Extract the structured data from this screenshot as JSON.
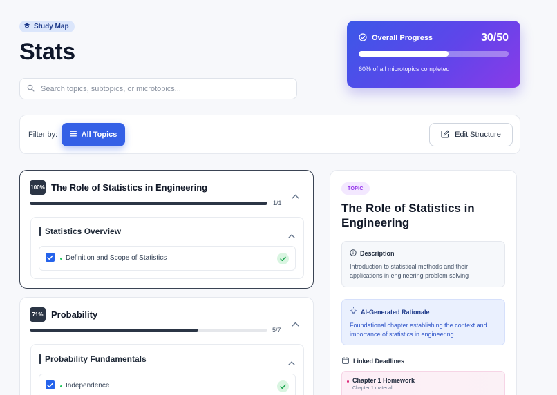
{
  "header": {
    "breadcrumb_pill": "Study Map",
    "page_title": "Stats"
  },
  "search": {
    "placeholder": "Search topics, subtopics, or microtopics..."
  },
  "overall_progress": {
    "label": "Overall Progress",
    "count": "30/50",
    "fraction": 0.6,
    "caption": "60% of all microtopics completed"
  },
  "filter": {
    "label": "Filter by:",
    "all_topics": "All Topics",
    "edit_structure": "Edit Structure"
  },
  "topics": [
    {
      "percent_label": "100%",
      "title": "The Role of Statistics in Engineering",
      "progress": 1.0,
      "count": "1/1",
      "subtopics": [
        {
          "title": "Statistics Overview",
          "microtopics": [
            {
              "label": "Definition and Scope of Statistics",
              "checked": true,
              "done": true
            }
          ]
        }
      ]
    },
    {
      "percent_label": "71%",
      "title": "Probability",
      "progress": 0.71,
      "count": "5/7",
      "subtopics": [
        {
          "title": "Probability Fundamentals",
          "microtopics": [
            {
              "label": "Independence",
              "checked": true,
              "done": true
            }
          ]
        }
      ]
    }
  ],
  "detail": {
    "type_pill": "TOPIC",
    "title": "The Role of Statistics in Engineering",
    "description_label": "Description",
    "description_text": "Introduction to statistical methods and their applications in engineering problem solving",
    "ai_label": "AI-Generated Rationale",
    "ai_text": "Foundational chapter establishing the context and importance of statistics in engineering",
    "linked_label": "Linked Deadlines",
    "deadlines": [
      {
        "title": "Chapter 1 Homework",
        "subtitle": "Chapter 1 material"
      }
    ]
  },
  "colors": {
    "primary": "#3460e6",
    "dark": "#2b3545",
    "success": "#22c55e",
    "purple": "#9333ea"
  }
}
